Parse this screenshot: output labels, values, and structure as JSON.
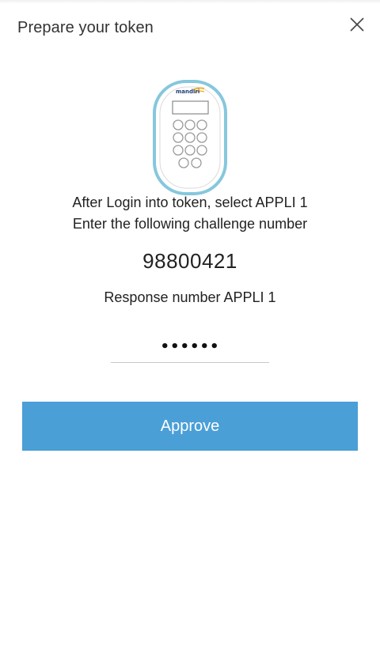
{
  "header": {
    "title": "Prepare your token",
    "close_icon": "close-icon"
  },
  "token": {
    "icon": "hardware-token-icon",
    "brand": "mandiri",
    "accent_color": "#7fc3dc"
  },
  "instructions": {
    "line1": "After Login into token, select APPLI 1",
    "line2": "Enter the following challenge number"
  },
  "challenge_number": "98800421",
  "response": {
    "label": "Response number APPLI 1",
    "value": "••••••"
  },
  "actions": {
    "approve_label": "Approve",
    "approve_color": "#4a9fd7"
  }
}
